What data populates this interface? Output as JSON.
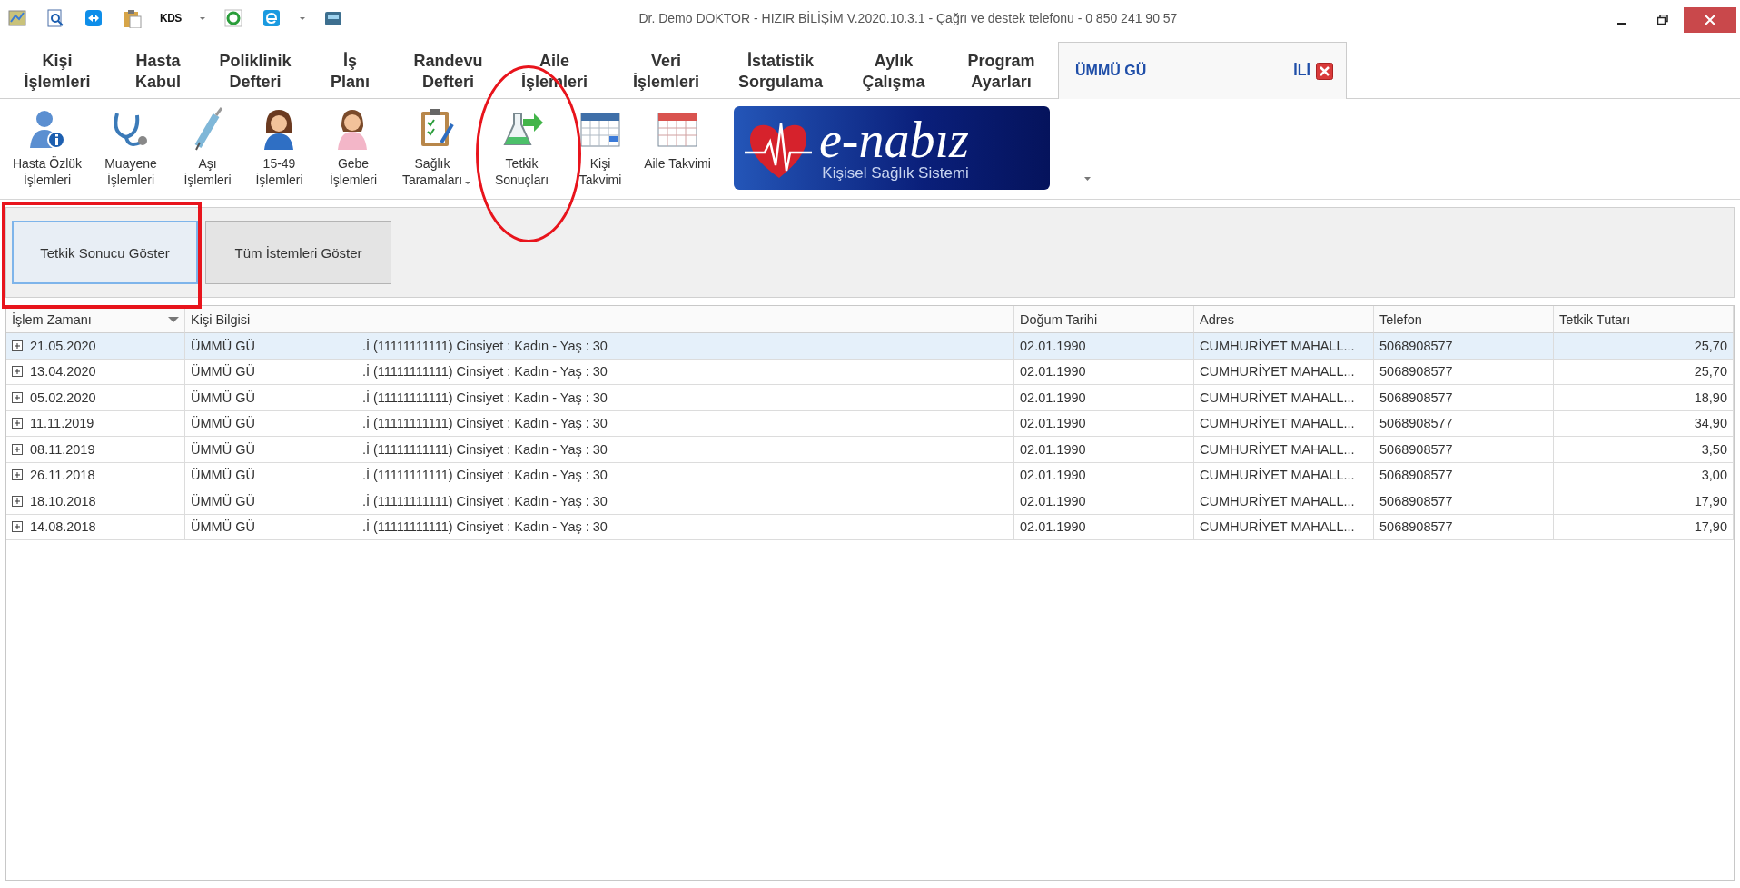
{
  "window": {
    "title": "Dr. Demo DOKTOR - HIZIR BİLİŞİM V.2020.10.3.1 - Çağrı ve destek telefonu - 0 850 241 90 57"
  },
  "quick_access": {
    "kds_label": "KDS"
  },
  "ribbon_tabs": [
    {
      "kind": "menu",
      "lines": [
        "Kişi",
        "İşlemleri"
      ],
      "selected": false
    },
    {
      "kind": "menu",
      "lines": [
        "Hasta",
        "Kabul"
      ],
      "selected": false
    },
    {
      "kind": "menu",
      "lines": [
        "Poliklinik",
        "Defteri"
      ],
      "selected": false
    },
    {
      "kind": "menu",
      "lines": [
        "İş",
        "Planı"
      ],
      "selected": false
    },
    {
      "kind": "menu",
      "lines": [
        "Randevu",
        "Defteri"
      ],
      "selected": false
    },
    {
      "kind": "menu",
      "lines": [
        "Aile",
        "İşlemleri"
      ],
      "selected": false
    },
    {
      "kind": "menu",
      "lines": [
        "Veri",
        "İşlemleri"
      ],
      "selected": false
    },
    {
      "kind": "menu",
      "lines": [
        "İstatistik",
        "Sorgulama"
      ],
      "selected": false
    },
    {
      "kind": "menu",
      "lines": [
        "Aylık",
        "Çalışma"
      ],
      "selected": false
    },
    {
      "kind": "menu",
      "lines": [
        "Program",
        "Ayarları"
      ],
      "selected": false
    },
    {
      "kind": "patient",
      "name_start": "ÜMMÜ GÜ",
      "name_end": "İLİ",
      "selected": true
    }
  ],
  "toolbar": [
    {
      "lines": [
        "Hasta Özlük",
        "İşlemleri"
      ],
      "dropdown": false
    },
    {
      "lines": [
        "Muayene",
        "İşlemleri"
      ],
      "dropdown": false
    },
    {
      "lines": [
        "Aşı",
        "İşlemleri"
      ],
      "dropdown": false
    },
    {
      "lines": [
        "15-49",
        "İşlemleri"
      ],
      "dropdown": false
    },
    {
      "lines": [
        "Gebe",
        "İşlemleri"
      ],
      "dropdown": false
    },
    {
      "lines": [
        "Sağlık",
        "Taramaları"
      ],
      "dropdown": true
    },
    {
      "lines": [
        "Tetkik",
        "Sonuçları"
      ],
      "dropdown": false
    },
    {
      "lines": [
        "Kişi",
        "Takvimi"
      ],
      "dropdown": false
    },
    {
      "lines": [
        "Aile Takvimi"
      ],
      "dropdown": false
    }
  ],
  "banner": {
    "title": "e-nabız",
    "subtitle": "Kişisel Sağlık Sistemi"
  },
  "actions": [
    {
      "label": "Tetkik Sonucu Göster",
      "selected": true
    },
    {
      "label": "Tüm İstemleri Göster",
      "selected": false
    }
  ],
  "table": {
    "columns": [
      {
        "label": "İşlem Zamanı",
        "sorted": true
      },
      {
        "label": "Kişi Bilgisi",
        "sorted": false
      },
      {
        "label": "Doğum Tarihi",
        "sorted": false
      },
      {
        "label": "Adres",
        "sorted": false
      },
      {
        "label": "Telefon",
        "sorted": false
      },
      {
        "label": "Tetkik Tutarı",
        "sorted": false
      }
    ],
    "rows": [
      {
        "selected": true,
        "date": "21.05.2020",
        "person_name": "ÜMMÜ GÜ",
        "person_info": ".İ (11111111111) Cinsiyet : Kadın - Yaş : 30",
        "birth_date": "02.01.1990",
        "address": "CUMHURİYET MAHALL...",
        "phone": "5068908577",
        "amount": "25,70"
      },
      {
        "selected": false,
        "date": "13.04.2020",
        "person_name": "ÜMMÜ GÜ",
        "person_info": ".İ (11111111111) Cinsiyet : Kadın - Yaş : 30",
        "birth_date": "02.01.1990",
        "address": "CUMHURİYET MAHALL...",
        "phone": "5068908577",
        "amount": "25,70"
      },
      {
        "selected": false,
        "date": "05.02.2020",
        "person_name": "ÜMMÜ GÜ",
        "person_info": ".İ (11111111111) Cinsiyet : Kadın - Yaş : 30",
        "birth_date": "02.01.1990",
        "address": "CUMHURİYET MAHALL...",
        "phone": "5068908577",
        "amount": "18,90"
      },
      {
        "selected": false,
        "date": "11.11.2019",
        "person_name": "ÜMMÜ GÜ",
        "person_info": ".İ (11111111111) Cinsiyet : Kadın - Yaş : 30",
        "birth_date": "02.01.1990",
        "address": "CUMHURİYET MAHALL...",
        "phone": "5068908577",
        "amount": "34,90"
      },
      {
        "selected": false,
        "date": "08.11.2019",
        "person_name": "ÜMMÜ GÜ",
        "person_info": ".İ (11111111111) Cinsiyet : Kadın - Yaş : 30",
        "birth_date": "02.01.1990",
        "address": "CUMHURİYET MAHALL...",
        "phone": "5068908577",
        "amount": "3,50"
      },
      {
        "selected": false,
        "date": "26.11.2018",
        "person_name": "ÜMMÜ GÜ",
        "person_info": ".İ (11111111111) Cinsiyet : Kadın - Yaş : 30",
        "birth_date": "02.01.1990",
        "address": "CUMHURİYET MAHALL...",
        "phone": "5068908577",
        "amount": "3,00"
      },
      {
        "selected": false,
        "date": "18.10.2018",
        "person_name": "ÜMMÜ GÜ",
        "person_info": ".İ (11111111111) Cinsiyet : Kadın - Yaş : 30",
        "birth_date": "02.01.1990",
        "address": "CUMHURİYET MAHALL...",
        "phone": "5068908577",
        "amount": "17,90"
      },
      {
        "selected": false,
        "date": "14.08.2018",
        "person_name": "ÜMMÜ GÜ",
        "person_info": ".İ (11111111111) Cinsiyet : Kadın - Yaş : 30",
        "birth_date": "02.01.1990",
        "address": "CUMHURİYET MAHALL...",
        "phone": "5068908577",
        "amount": "17,90"
      }
    ]
  },
  "annotations": [
    {
      "kind": "ellipse"
    },
    {
      "kind": "rectangle"
    }
  ]
}
